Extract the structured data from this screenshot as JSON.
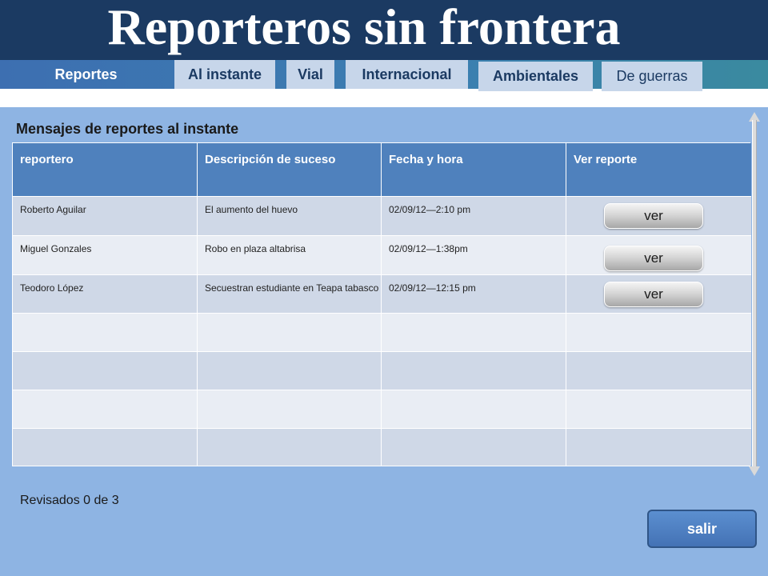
{
  "app": {
    "title": "Reporteros sin frontera"
  },
  "nav": {
    "tabs": [
      {
        "label": "Reportes"
      },
      {
        "label": "Al instante"
      },
      {
        "label": "Vial"
      },
      {
        "label": "Internacional"
      },
      {
        "label": "Ambientales"
      },
      {
        "label": "De guerras"
      }
    ]
  },
  "section": {
    "title": "Mensajes de reportes al instante"
  },
  "table": {
    "headers": [
      "reportero",
      "Descripción de suceso",
      "Fecha y hora",
      "Ver reporte"
    ],
    "rows": [
      {
        "reportero": "Roberto Aguilar",
        "descripcion": "El aumento del huevo",
        "fecha": "02/09/12—2:10 pm",
        "accion": "ver"
      },
      {
        "reportero": "Miguel Gonzales",
        "descripcion": "Robo  en plaza altabrisa",
        "fecha": "02/09/12—1:38pm",
        "accion": "ver"
      },
      {
        "reportero": "Teodoro López",
        "descripcion": "Secuestran estudiante en Teapa tabasco",
        "fecha": "02/09/12—12:15 pm",
        "accion": "ver"
      }
    ]
  },
  "status": {
    "text": "Revisados 0 de 3"
  },
  "actions": {
    "salir": "salir"
  },
  "colors": {
    "header_bg": "#1b3a62",
    "main_bg": "#8eb4e3",
    "table_header": "#4f81bd",
    "row_dark": "#cfd8e7",
    "row_light": "#e9edf4"
  }
}
